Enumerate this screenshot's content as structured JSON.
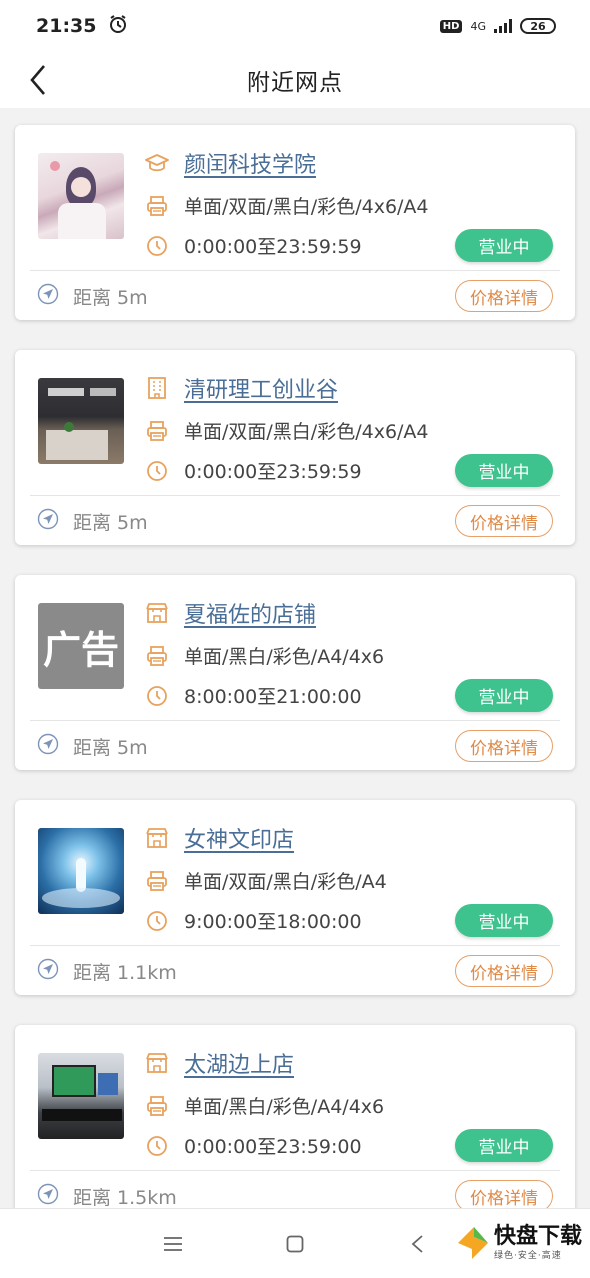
{
  "status_bar": {
    "time": "21:35",
    "hd": "HD",
    "network": "4G",
    "battery": "26"
  },
  "header": {
    "title": "附近网点"
  },
  "stores": [
    {
      "name": "颜闰科技学院",
      "icon": "graduation-cap-icon",
      "services": "单面/双面/黑白/彩色/4x6/A4",
      "hours": "0:00:00至23:59:59",
      "status": "营业中",
      "distance": "距离 5m",
      "price_label": "价格详情",
      "thumb": "anime"
    },
    {
      "name": "清研理工创业谷",
      "icon": "building-icon",
      "services": "单面/双面/黑白/彩色/4x6/A4",
      "hours": "0:00:00至23:59:59",
      "status": "营业中",
      "distance": "距离 5m",
      "price_label": "价格详情",
      "thumb": "office"
    },
    {
      "name": "夏福佐的店铺",
      "icon": "store-icon",
      "services": "单面/黑白/彩色/A4/4x6",
      "hours": "8:00:00至21:00:00",
      "status": "营业中",
      "distance": "距离 5m",
      "price_label": "价格详情",
      "thumb": "ad",
      "thumb_text": "广告"
    },
    {
      "name": "女神文印店",
      "icon": "store-icon",
      "services": "单面/双面/黑白/彩色/A4",
      "hours": "9:00:00至18:00:00",
      "status": "营业中",
      "distance": "距离 1.1km",
      "price_label": "价格详情",
      "thumb": "ice"
    },
    {
      "name": "太湖边上店",
      "icon": "store-icon",
      "services": "单面/黑白/彩色/A4/4x6",
      "hours": "0:00:00至23:59:00",
      "status": "营业中",
      "distance": "距离 1.5km",
      "price_label": "价格详情",
      "thumb": "desk"
    }
  ],
  "watermark": {
    "brand": "快盘下载",
    "tagline": "绿色·安全·高速"
  },
  "colors": {
    "accent": "#e8a25e",
    "status_green": "#3ec28e",
    "link_blue": "#4a6e96"
  }
}
